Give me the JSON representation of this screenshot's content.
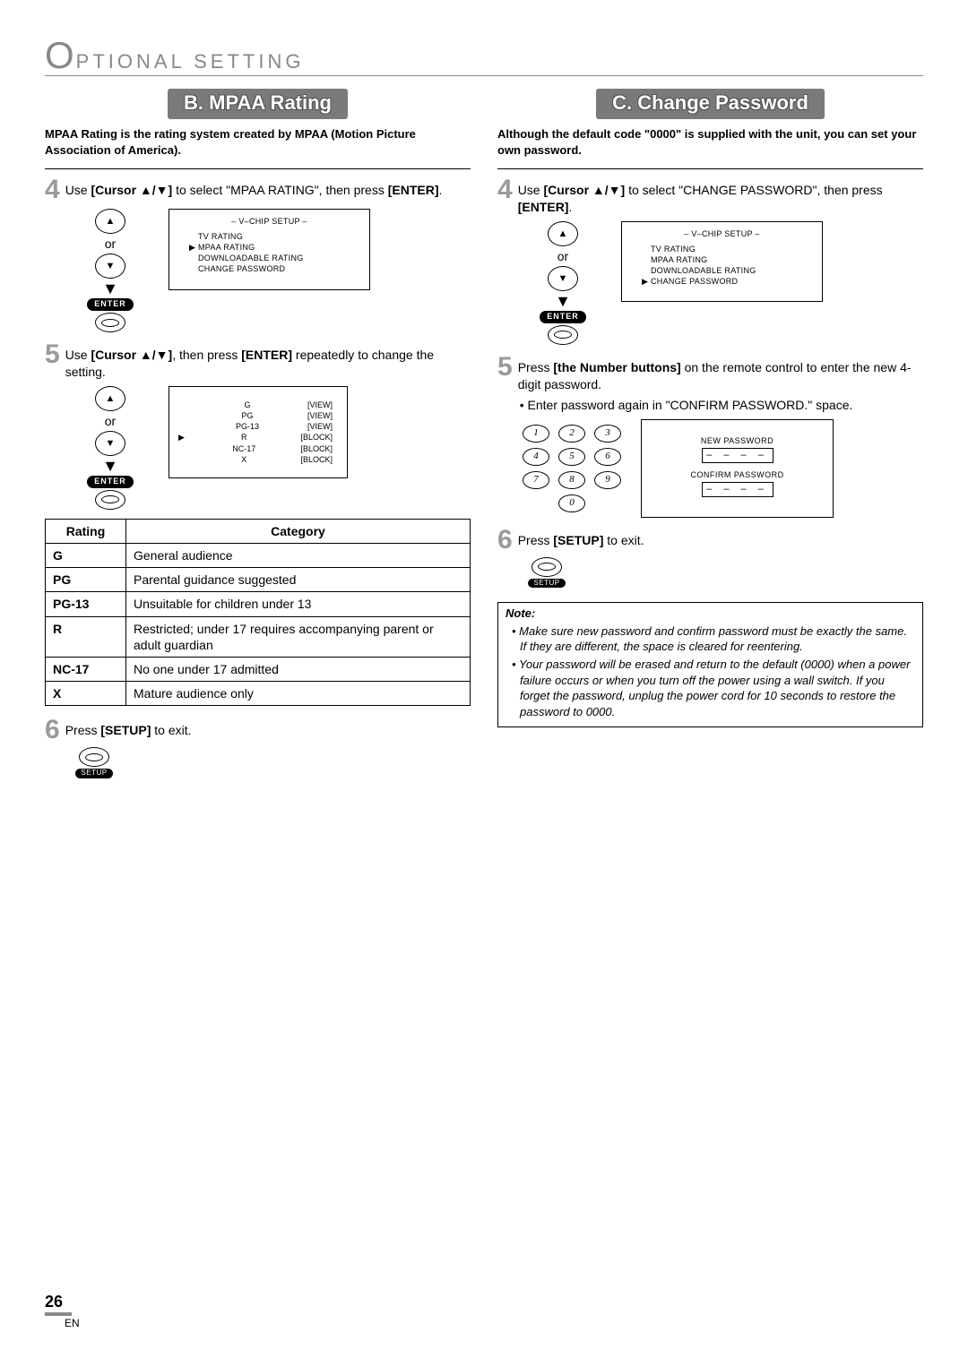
{
  "header": {
    "big_o": "O",
    "rest": "PTIONAL  SETTING"
  },
  "sectionB": {
    "title": "B.  MPAA Rating",
    "intro": "MPAA Rating is the rating system created by MPAA (Motion Picture Association of America).",
    "step4_a": "Use ",
    "step4_b": "[Cursor ▲/▼]",
    "step4_c": " to select \"MPAA RATING\", then press ",
    "step4_d": "[ENTER]",
    "step4_e": ".",
    "menu_title": "–  V–CHIP SETUP  –",
    "menu_items": [
      "TV RATING",
      "MPAA RATING",
      "DOWNLOADABLE RATING",
      "CHANGE PASSWORD"
    ],
    "step5_a": "Use ",
    "step5_b": "[Cursor ▲/▼]",
    "step5_c": ", then press ",
    "step5_d": "[ENTER]",
    "step5_e": " repeatedly to change the setting.",
    "rating_menu": [
      {
        "code": "G",
        "state": "[VIEW]"
      },
      {
        "code": "PG",
        "state": "[VIEW]"
      },
      {
        "code": "PG-13",
        "state": "[VIEW]"
      },
      {
        "code": "R",
        "state": "[BLOCK]"
      },
      {
        "code": "NC-17",
        "state": "[BLOCK]"
      },
      {
        "code": "X",
        "state": "[BLOCK]"
      }
    ],
    "table_headers": [
      "Rating",
      "Category"
    ],
    "table_rows": [
      {
        "r": "G",
        "c": "General audience"
      },
      {
        "r": "PG",
        "c": "Parental guidance suggested"
      },
      {
        "r": "PG-13",
        "c": "Unsuitable for children under 13"
      },
      {
        "r": "R",
        "c": "Restricted; under 17 requires accompanying parent or adult guardian"
      },
      {
        "r": "NC-17",
        "c": "No one under 17 admitted"
      },
      {
        "r": "X",
        "c": "Mature audience only"
      }
    ],
    "step6_a": "Press ",
    "step6_b": "[SETUP]",
    "step6_c": " to exit."
  },
  "sectionC": {
    "title": "C.  Change Password",
    "intro": "Although the default code \"0000\" is supplied with the unit, you can set your own password.",
    "step4_a": "Use ",
    "step4_b": "[Cursor ▲/▼]",
    "step4_c": " to select \"CHANGE PASSWORD\", then press ",
    "step4_d": "[ENTER]",
    "step4_e": ".",
    "menu_title": "–  V–CHIP SETUP  –",
    "menu_items": [
      "TV RATING",
      "MPAA RATING",
      "DOWNLOADABLE RATING",
      "CHANGE PASSWORD"
    ],
    "step5_a": "Press ",
    "step5_b": "[the Number buttons]",
    "step5_c": " on the remote control to enter the new 4-digit password.",
    "step5_bullet": "Enter password again in \"CONFIRM PASSWORD.\" space.",
    "numpad": [
      "1",
      "2",
      "3",
      "4",
      "5",
      "6",
      "7",
      "8",
      "9",
      "0"
    ],
    "pw_new": "NEW PASSWORD",
    "pw_confirm": "CONFIRM PASSWORD",
    "pw_dashes": "– – – –",
    "step6_a": "Press ",
    "step6_b": "[SETUP]",
    "step6_c": " to exit.",
    "note_title": "Note:",
    "notes": [
      "Make sure new password and confirm password must be exactly the same. If they are different, the space is cleared for reentering.",
      "Your password will be erased and return to the default (0000) when a power failure occurs or when you turn off the power using a wall switch. If you forget the password, unplug the power cord for 10 seconds to restore the password to 0000."
    ]
  },
  "remote": {
    "or": "or",
    "enter": "ENTER",
    "setup": "SETUP"
  },
  "footer": {
    "page": "26",
    "lang": "EN"
  },
  "step_numbers": {
    "n4": "4",
    "n5": "5",
    "n6": "6"
  }
}
